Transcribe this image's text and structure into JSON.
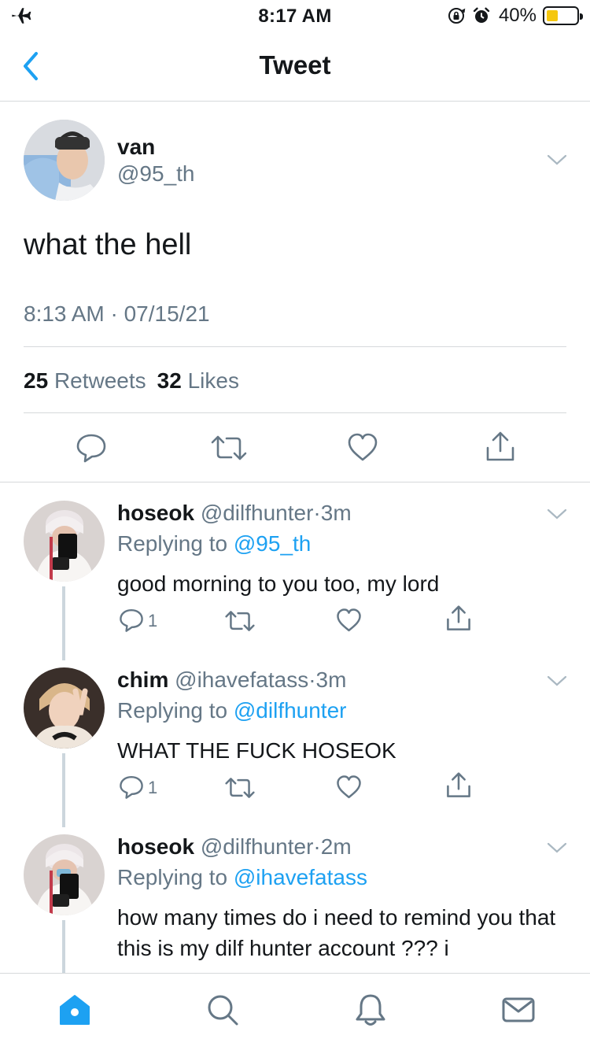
{
  "status_bar": {
    "time": "8:17 AM",
    "battery_percent": "40%",
    "battery_level": 0.4,
    "icons": [
      "airplane-icon",
      "rotation-lock-icon",
      "alarm-icon",
      "battery-icon"
    ]
  },
  "header": {
    "title": "Tweet"
  },
  "main_tweet": {
    "name": "van",
    "handle": "@95_th",
    "text": "what the hell",
    "timestamp": "8:13 AM · 07/15/21",
    "retweets_count": "25",
    "retweets_label": "Retweets",
    "likes_count": "32",
    "likes_label": "Likes"
  },
  "replies": [
    {
      "name": "hoseok",
      "handle": "@dilfhunter",
      "dot": "·",
      "time": "3m",
      "replying_label": "Replying to",
      "replying_to": "@95_th",
      "text": "good morning to you too, my lord",
      "reply_count": "1"
    },
    {
      "name": "chim",
      "handle": "@ihavefatass",
      "dot": "·",
      "time": "3m",
      "replying_label": "Replying to",
      "replying_to": "@dilfhunter",
      "text": "WHAT THE FUCK HOSEOK",
      "reply_count": "1"
    },
    {
      "name": "hoseok",
      "handle": "@dilfhunter",
      "dot": "·",
      "time": "2m",
      "replying_label": "Replying to",
      "replying_to": "@ihavefatass",
      "text": "how many times do i need to remind you that this is my dilf hunter account ??? i",
      "reply_count": ""
    }
  ],
  "tab_bar": {
    "tabs": [
      "home-icon",
      "search-icon",
      "notifications-icon",
      "messages-icon"
    ],
    "active": "home-icon"
  },
  "colors": {
    "accent": "#1da1f2",
    "secondary_text": "#657786",
    "divider": "#d6d9db",
    "battery_fill": "#f5c70f"
  }
}
